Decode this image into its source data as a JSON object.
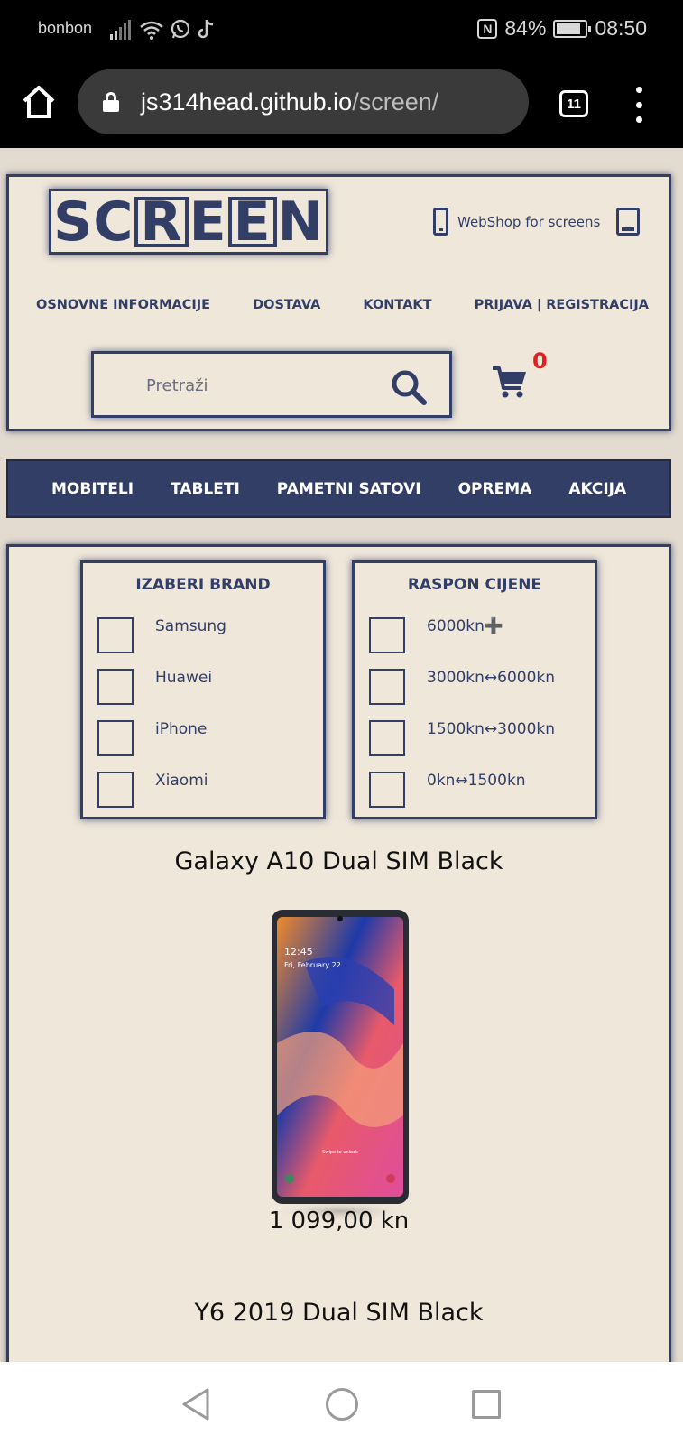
{
  "status_bar": {
    "carrier": "bonbon",
    "battery": "84%",
    "battery_level": 0.84,
    "time": "08:50",
    "icons": [
      "signal-icon",
      "wifi-icon",
      "whatsapp-icon",
      "tiktok-icon",
      "nfc-icon",
      "battery-icon"
    ]
  },
  "browser": {
    "url_host": "js314head.github.io",
    "url_path": "/screen/",
    "tab_count": "11"
  },
  "header": {
    "logo_letters": [
      "S",
      "C",
      "R",
      "E",
      "E",
      "N"
    ],
    "logo_boxed": [
      false,
      false,
      true,
      false,
      true,
      false
    ],
    "tagline": "WebShop for screens",
    "nav": [
      {
        "label": "OSNOVNE INFORMACIJE"
      },
      {
        "label": "DOSTAVA"
      },
      {
        "label": "KONTAKT"
      },
      {
        "label": "PRIJAVA | REGISTRACIJA"
      }
    ],
    "search_placeholder": "Pretraži",
    "cart_count": "0"
  },
  "categories": [
    {
      "label": "MOBITELI"
    },
    {
      "label": "TABLETI"
    },
    {
      "label": "PAMETNI SATOVI"
    },
    {
      "label": "OPREMA"
    },
    {
      "label": "AKCIJA"
    }
  ],
  "filters": {
    "brand": {
      "title": "IZABERI BRAND",
      "options": [
        "Samsung",
        "Huawei",
        "iPhone",
        "Xiaomi"
      ]
    },
    "price": {
      "title": "RASPON CIJENE",
      "options": [
        "6000kn➕",
        "3000kn↔6000kn",
        "1500kn↔3000kn",
        "0kn↔1500kn"
      ]
    }
  },
  "products": [
    {
      "name": "Galaxy A10 Dual SIM Black",
      "price": "1 099,00 kn",
      "screen_time": "12:45",
      "screen_date": "Fri, February 22",
      "screen_hint": "Swipe to unlock"
    },
    {
      "name": "Y6 2019 Dual SIM Black"
    }
  ],
  "colors": {
    "brand": "#323e66",
    "background": "#efe7da",
    "cart_count": "#e02020"
  }
}
